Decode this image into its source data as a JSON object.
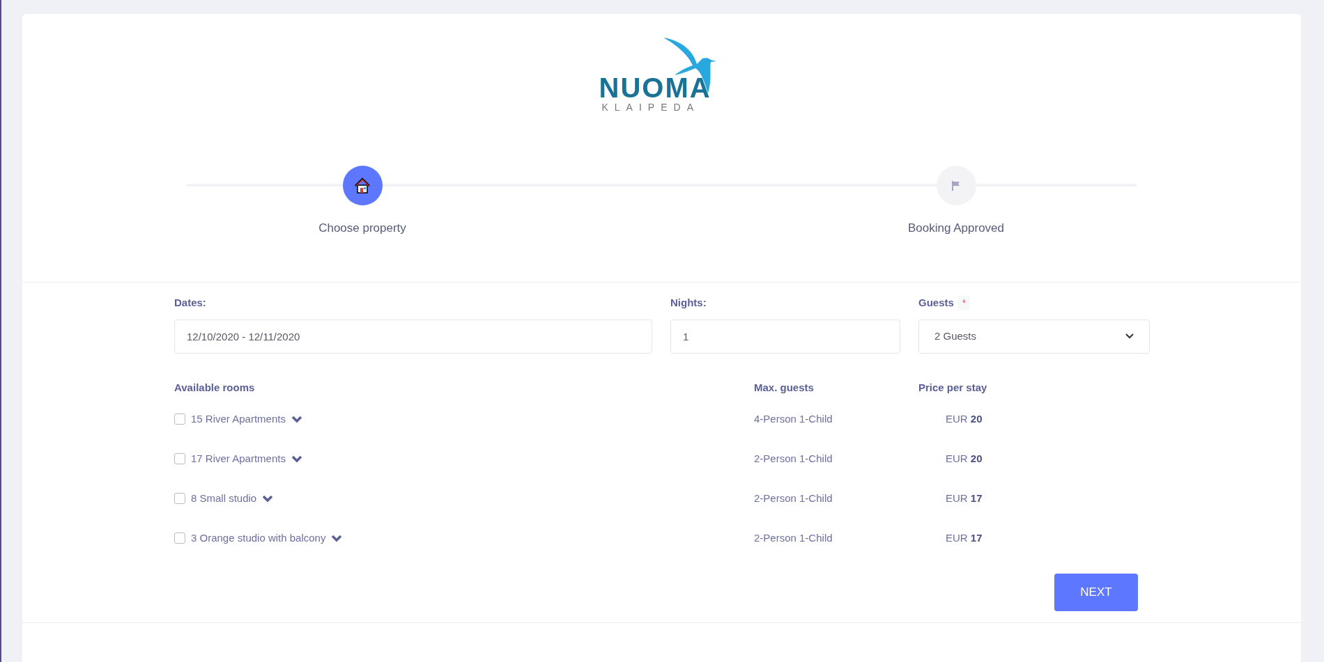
{
  "logo": {
    "name": "NUOMA",
    "subtitle": "KLAIPEDA"
  },
  "steps": [
    {
      "label": "Choose property",
      "kind": "home",
      "active": true
    },
    {
      "label": "Booking Approved",
      "kind": "flag",
      "active": false
    }
  ],
  "form": {
    "dates_label": "Dates:",
    "dates_value": "12/10/2020 - 12/11/2020",
    "nights_label": "Nights:",
    "nights_value": "1",
    "guests_label": "Guests",
    "guests_required": "*",
    "guests_value": "2 Guests"
  },
  "table": {
    "columns": [
      "Available rooms",
      "Max. guests",
      "Price per stay"
    ],
    "rows": [
      {
        "name": "15 River Apartments",
        "checked": false,
        "max_guests": "4-Person 1-Child",
        "currency": "EUR",
        "price": "20"
      },
      {
        "name": "17 River Apartments",
        "checked": false,
        "max_guests": "2-Person 1-Child",
        "currency": "EUR",
        "price": "20"
      },
      {
        "name": "8 Small studio",
        "checked": false,
        "max_guests": "2-Person 1-Child",
        "currency": "EUR",
        "price": "17"
      },
      {
        "name": "3 Orange studio with balcony",
        "checked": false,
        "max_guests": "2-Person 1-Child",
        "currency": "EUR",
        "price": "17"
      }
    ]
  },
  "next_button": "NEXT"
}
